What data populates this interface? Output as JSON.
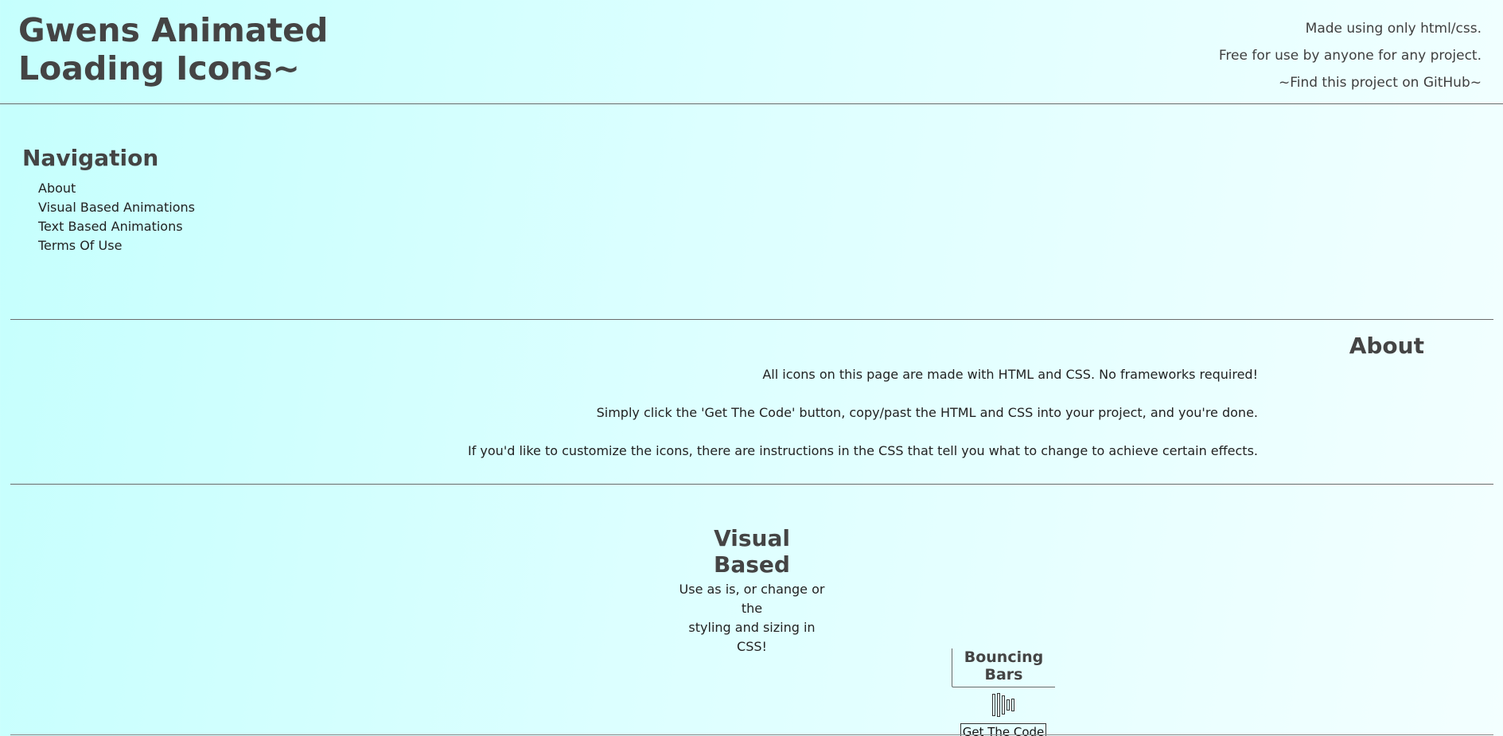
{
  "header": {
    "title_line1": "Gwens Animated",
    "title_line2": "Loading Icons~",
    "links": [
      "Made using only html/css.",
      "Free for use by anyone for any project.",
      "~Find this project on GitHub~"
    ]
  },
  "nav": {
    "title": "Navigation",
    "items": [
      "About",
      "Visual Based Animations",
      "Text Based Animations",
      "Terms Of Use"
    ]
  },
  "about": {
    "title": "About",
    "paragraphs": [
      "All icons on this page are made with HTML and CSS. No frameworks required!",
      "Simply click the 'Get The Code' button, copy/past the HTML and CSS into your project, and you're done.",
      "If you'd like to customize the icons, there are instructions in the CSS that tell you what to change to achieve certain effects."
    ]
  },
  "visual": {
    "title": "Visual Based",
    "subtitle_line1": "Use as is, or change or the",
    "subtitle_line2": "styling and sizing in CSS!"
  },
  "card": {
    "title": "Bouncing Bars",
    "button_label": "Get The Code"
  },
  "colors": {
    "text": "#454545",
    "background_start": "#c5fffd",
    "background_end": "#f3ffff"
  }
}
